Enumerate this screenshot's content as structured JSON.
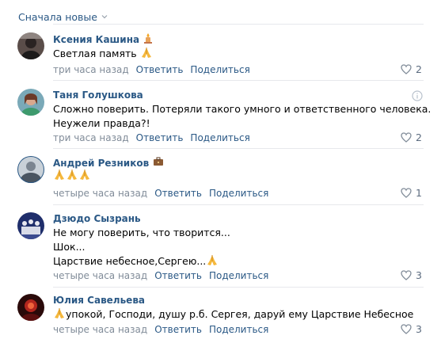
{
  "sort": {
    "label": "Сначала новые"
  },
  "actions": {
    "reply": "Ответить",
    "share": "Поделиться"
  },
  "comments": [
    {
      "author": "Ксения Кашина",
      "lines": [
        "Светлая память"
      ],
      "time": "три часа назад",
      "likes": "2",
      "badge": "candle-emoji",
      "emoji": "pray-emoji"
    },
    {
      "author": "Таня Голушкова",
      "lines": [
        "Сложно поверить. Потеряли такого умного и ответственного человека.",
        "Неужели правда?!"
      ],
      "time": "три часа назад",
      "likes": "2"
    },
    {
      "author": "Андрей Резников",
      "lines": [
        ""
      ],
      "time": "четыре часа назад",
      "likes": "1",
      "badge": "briefcase-emoji",
      "emoji": "pray-emoji x3"
    },
    {
      "author": "Дзюдо Сызрань",
      "lines": [
        "Не могу поверить, что творится...",
        "Шок...",
        "Царствие небесное,Сергею..."
      ],
      "time": "четыре часа назад",
      "likes": "3",
      "emoji": "pray-emoji"
    },
    {
      "author": "Юлия Савельева",
      "lines": [
        "упокой, Господи, душу р.б. Сергея, даруй ему Царствие Небесное"
      ],
      "time": "четыре часа назад",
      "likes": "3",
      "emoji": "pray-emoji"
    }
  ],
  "colors": {
    "link": "#2a5885",
    "meta": "#818c99",
    "divider": "#e7e8ec"
  }
}
